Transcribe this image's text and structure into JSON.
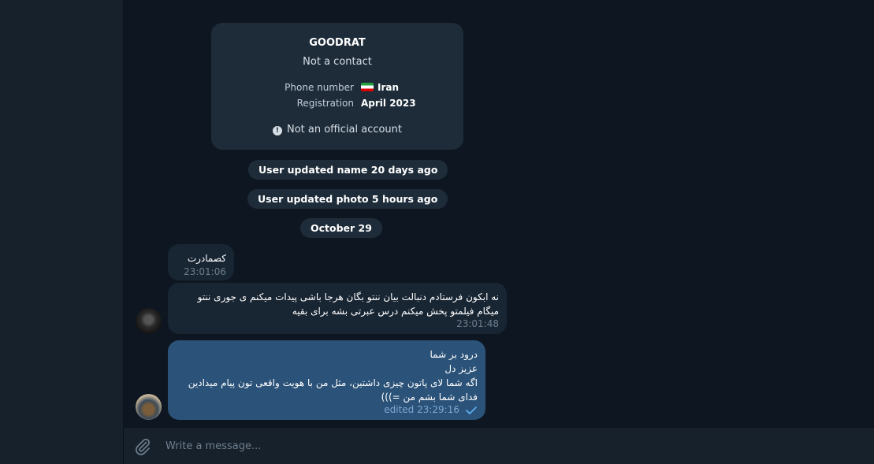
{
  "info_card": {
    "name": "GOODRAT",
    "status": "Not a contact",
    "rows": [
      {
        "label": "Phone number",
        "value": "Iran",
        "flag": "iran-flag"
      },
      {
        "label": "Registration",
        "value": "April 2023"
      }
    ],
    "note": "Not an official account",
    "note_icon": "!"
  },
  "service_messages": [
    "User updated name 20 days ago",
    "User updated photo 5 hours ago",
    "October 29"
  ],
  "messages": [
    {
      "direction": "in",
      "lines": [
        "کصمادرت"
      ],
      "time": "23:01:06"
    },
    {
      "direction": "in",
      "lines": [
        "نه ابکون فرستادم دنبالت بیان ننتو بگان هرجا باشی پیدات میکنم ی جوری ننتو",
        "میگام فیلمتو پخش میکنم درس عبرتی بشه برای بقیه"
      ],
      "time": "23:01:48"
    },
    {
      "direction": "out",
      "lines": [
        "درود بر شما",
        "عزیز دل",
        "اگه شما لای پاتون چیزی داشتین، مثل من با هویت واقعی تون پیام میدادین",
        "فدای شما بشم من =)))"
      ],
      "time": "edited 23:29:16",
      "read": true
    }
  ],
  "composer": {
    "placeholder": "Write a message..."
  },
  "colors": {
    "background": "#0e1621",
    "panel": "#17212b",
    "incoming_bubble": "#182533",
    "outgoing_bubble": "#2b5278",
    "accent": "#5eb5f7"
  }
}
